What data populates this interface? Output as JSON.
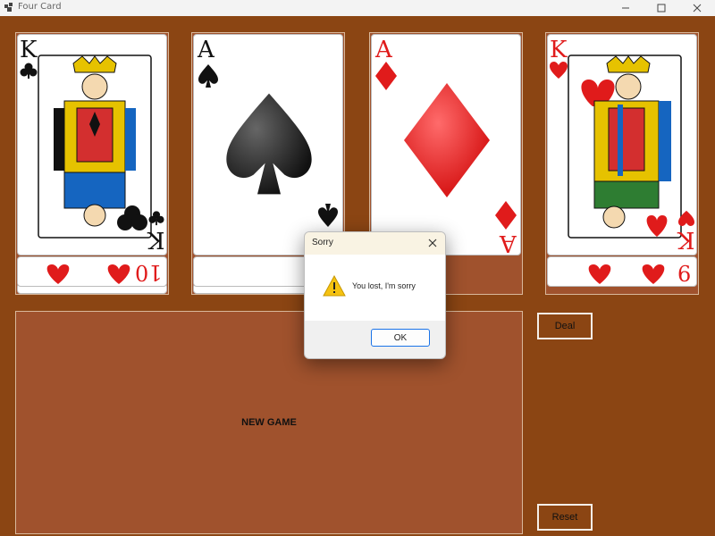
{
  "window": {
    "title": "Four Card",
    "controls": [
      "minimize",
      "maximize",
      "close"
    ]
  },
  "cards": [
    {
      "name": "king-of-clubs",
      "rank": "K",
      "suit": "clubs",
      "color": "#111111",
      "under_rank": "10",
      "under_suit": "hearts"
    },
    {
      "name": "ace-of-spades",
      "rank": "A",
      "suit": "spades",
      "color": "#111111",
      "under_rank": "",
      "under_suit": ""
    },
    {
      "name": "ace-of-diamonds",
      "rank": "A",
      "suit": "diamonds",
      "color": "#e01b1b",
      "under_rank": "",
      "under_suit": ""
    },
    {
      "name": "king-of-hearts",
      "rank": "K",
      "suit": "hearts",
      "color": "#e01b1b",
      "under_rank": "9",
      "under_suit": "hearts"
    }
  ],
  "board": {
    "label": "NEW GAME"
  },
  "buttons": {
    "deal": "Deal",
    "reset": "Reset"
  },
  "dialog": {
    "title": "Sorry",
    "message": "You lost, I'm sorry",
    "ok": "OK",
    "icon": "warning-icon"
  },
  "colors": {
    "table": "#8B4513",
    "board": "#A0522D",
    "accent": "#1a73e8",
    "red_suit": "#e01b1b"
  }
}
